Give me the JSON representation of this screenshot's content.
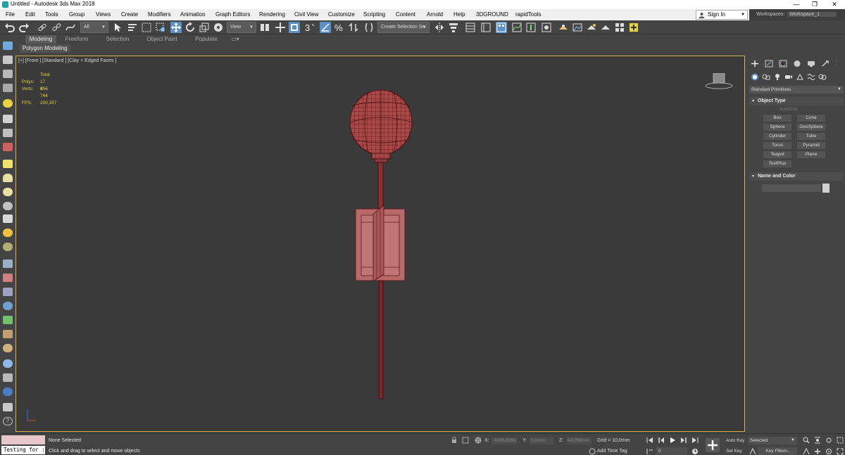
{
  "window": {
    "title": "Untitled - Autodesk 3ds Max 2018",
    "minimize": "—",
    "maximize": "❐",
    "close": "✕"
  },
  "menu": {
    "items": [
      "File",
      "Edit",
      "Tools",
      "Group",
      "Views",
      "Create",
      "Modifiers",
      "Animation",
      "Graph Editors",
      "Rendering",
      "Civil View",
      "Customize",
      "Scripting",
      "Content",
      "Arnold",
      "Help",
      "3DGROUND",
      "rapidTools"
    ],
    "sign_in": "Sign In",
    "workspaces_label": "Workspaces:",
    "workspace_value": "Workspace_1"
  },
  "toolbar": {
    "filter_value": "All",
    "reference_value": "View",
    "selection_set_placeholder": "Create Selection Se"
  },
  "ribbon": {
    "tabs": [
      "Modeling",
      "Freeform",
      "Selection",
      "Object Paint",
      "Populate"
    ],
    "active_tab": "Modeling",
    "sub_panel": "Polygon Modeling"
  },
  "viewport": {
    "label": "[+] [Front ] [Standard ] [Clay + Edged Faces ]",
    "stats": {
      "total_label": "Total",
      "polys_label": "Polys:",
      "polys_value": "17 456",
      "verts_label": "Verts:",
      "verts_value": "8 744",
      "fps_label": "FPS:",
      "fps_value": "200,357"
    }
  },
  "command_panel": {
    "category_dropdown": "Standard Primitives",
    "object_type_title": "Object Type",
    "autogrid_label": "AutoGrid",
    "object_buttons": [
      "Box",
      "Cone",
      "Sphere",
      "GeoSphere",
      "Cylinder",
      "Tube",
      "Torus",
      "Pyramid",
      "Teapot",
      "Plane",
      "TextPlus"
    ],
    "name_color_title": "Name and Color"
  },
  "status": {
    "maxscript_input": "Testing for :",
    "selection_status": "None Selected",
    "prompt": "Click and drag to select and move objects",
    "x_label": "X:",
    "x_value": "-5686,839n",
    "y_label": "Y:",
    "y_value": "0,0mm",
    "z_label": "Z:",
    "z_value": "54,059mm",
    "grid": "Grid = 10,0mm",
    "add_time_tag": "Add Time Tag",
    "auto_key": "Auto Key",
    "set_key": "Set Key",
    "selected_dropdown": "Selected",
    "key_filters": "Key Filters...",
    "frame_value": "0"
  },
  "colors": {
    "viewport_border": "#d2b04c",
    "stats_text": "#e6d23a",
    "model_red": "#a84848",
    "highlight_blue": "#5b8fc7"
  }
}
